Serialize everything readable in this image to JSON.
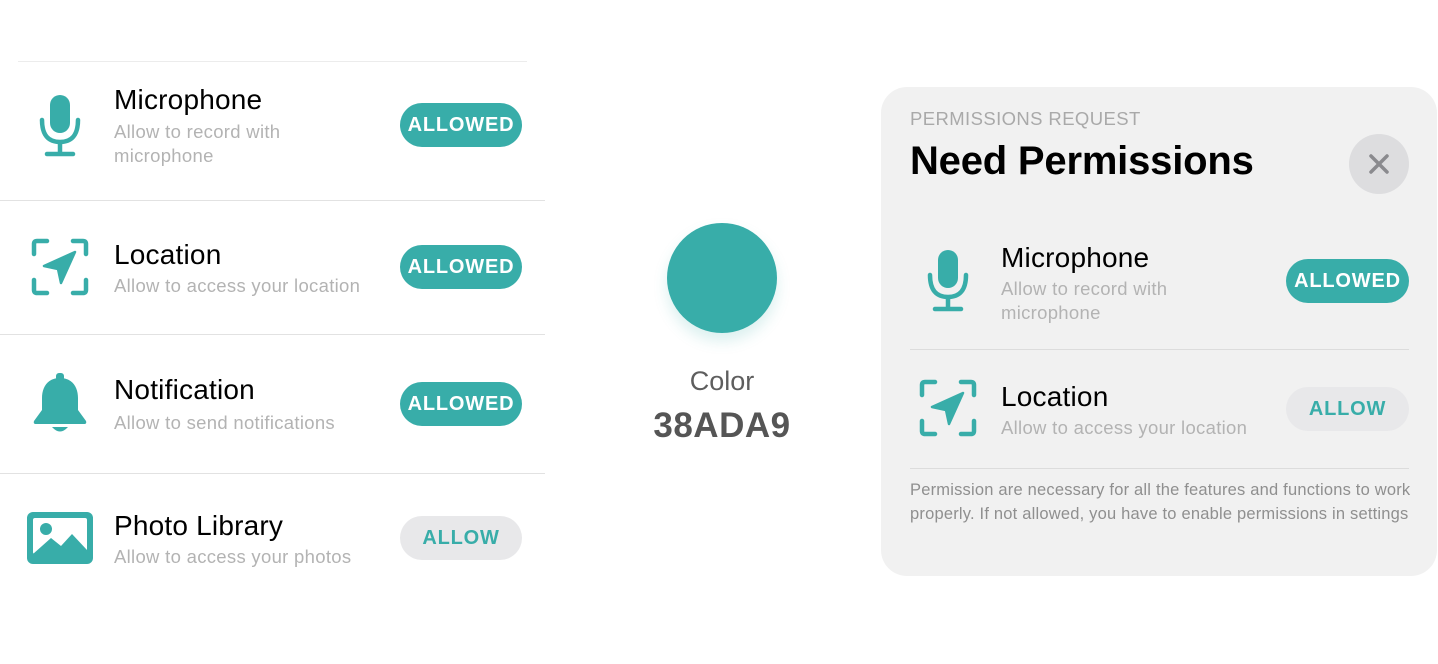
{
  "accent_color": "#38ADA9",
  "permissions_list": {
    "items": [
      {
        "title": "Microphone",
        "subtitle": "Allow to record with microphone",
        "icon": "microphone-icon",
        "status": "ALLOWED"
      },
      {
        "title": "Location",
        "subtitle": "Allow to access your location",
        "icon": "location-arrow-icon",
        "status": "ALLOWED"
      },
      {
        "title": "Notification",
        "subtitle": "Allow to send notifications",
        "icon": "bell-icon",
        "status": "ALLOWED"
      },
      {
        "title": "Photo Library",
        "subtitle": "Allow to access your photos",
        "icon": "photo-icon",
        "status": "ALLOW"
      }
    ]
  },
  "color_swatch": {
    "label": "Color",
    "hex": "38ADA9",
    "color": "#38ADA9"
  },
  "dialog": {
    "kicker": "PERMISSIONS REQUEST",
    "title": "Need Permissions",
    "close_icon": "close-icon",
    "items": [
      {
        "title": "Microphone",
        "subtitle": "Allow to record with microphone",
        "icon": "microphone-icon",
        "status": "ALLOWED"
      },
      {
        "title": "Location",
        "subtitle": "Allow to access your location",
        "icon": "location-arrow-icon",
        "status": "ALLOW"
      }
    ],
    "footnote": "Permission are necessary for all the features and functions to work properly. If not allowed, you have to enable permissions in settings"
  }
}
